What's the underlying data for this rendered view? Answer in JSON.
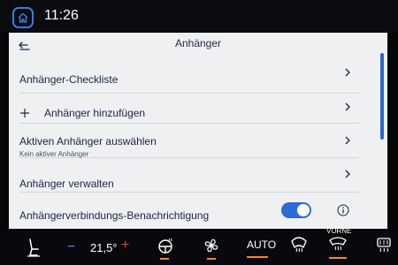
{
  "status_bar": {
    "time": "11:26",
    "home_icon": "home-icon"
  },
  "header": {
    "title": "Anhänger",
    "back_icon": "back-arrow-icon"
  },
  "menu": [
    {
      "label": "Anhänger-Checkliste",
      "icon": "chevron-right-icon"
    },
    {
      "label": "Anhänger hinzufügen",
      "leading_icon": "plus-icon",
      "icon": "chevron-right-icon"
    },
    {
      "label": "Aktiven Anhänger auswählen",
      "sublabel": "Kein aktiver Anhänger",
      "icon": "chevron-right-icon"
    },
    {
      "label": "Anhänger verwalten",
      "icon": "chevron-right-icon"
    },
    {
      "label": "Anhängerverbindungs-Benachrichtigung",
      "toggle_state": "on",
      "icon": "info-icon"
    }
  ],
  "climate": {
    "temperature": "21,5°",
    "auto_label": "AUTO",
    "vorne_label": "VORNE"
  },
  "colors": {
    "accent": "#2f6bd6",
    "screen_bg": "#eef0f2",
    "indicator": "#f08a1c"
  }
}
